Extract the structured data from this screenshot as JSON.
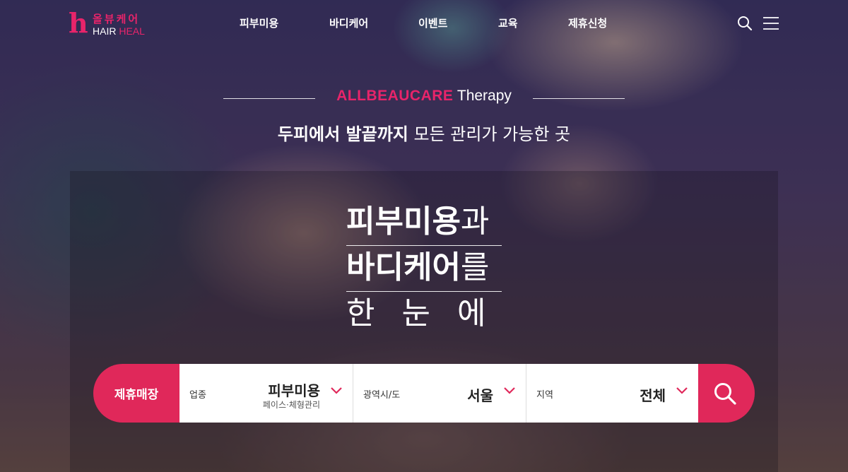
{
  "header": {
    "logo": {
      "mark": "h",
      "korean": "올뷰케어",
      "english_hair": "HAIR",
      "english_heal": "HEAL"
    },
    "nav": [
      {
        "label": "피부미용"
      },
      {
        "label": "바디케어"
      },
      {
        "label": "이벤트"
      },
      {
        "label": "교육"
      },
      {
        "label": "제휴신청"
      }
    ],
    "icons": {
      "search": "search-icon",
      "menu": "hamburger-menu-icon"
    }
  },
  "hero": {
    "subtitle_brand": "ALLBEAUCARE",
    "subtitle_rest": " Therapy",
    "tagline_strong": "두피에서 발끝까지",
    "tagline_rest": " 모든 관리가 가능한 곳",
    "headline": {
      "line1_bold": "피부미용",
      "line1_light": "과",
      "line2_bold": "바디케어",
      "line2_light": "를",
      "line3": "한눈에"
    }
  },
  "search": {
    "label": "제휴매장",
    "fields": [
      {
        "key": "업종",
        "value": "피부미용",
        "subvalue": "페이스·체형관리"
      },
      {
        "key": "광역시/도",
        "value": "서울"
      },
      {
        "key": "지역",
        "value": "전체"
      }
    ]
  },
  "colors": {
    "accent": "#e0285a",
    "brand_pink": "#e8246a",
    "text_light": "#ffffff"
  }
}
